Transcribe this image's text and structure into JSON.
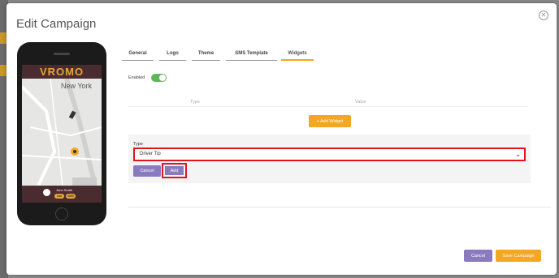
{
  "modal": {
    "title": "Edit Campaign",
    "close_icon": "close-icon"
  },
  "phone": {
    "brand": "VROMO",
    "city": "New York",
    "driver_name": "John Smith",
    "chip_call": "Call",
    "chip_sms": "SMS"
  },
  "tabs": [
    {
      "label": "General",
      "active": false
    },
    {
      "label": "Logo",
      "active": false
    },
    {
      "label": "Theme",
      "active": false
    },
    {
      "label": "SMS Template",
      "active": false
    },
    {
      "label": "Widgets",
      "active": true
    }
  ],
  "widgets": {
    "enabled_label": "Enabled",
    "enabled": true,
    "col_type": "Type",
    "col_value": "Value",
    "add_widget_label": "+ Add Widget",
    "form": {
      "type_label": "Type",
      "type_value": "Driver Tip",
      "cancel_label": "Cancel",
      "add_label": "Add"
    }
  },
  "footer": {
    "cancel_label": "Cancel",
    "save_label": "Save Campaign"
  },
  "colors": {
    "accent": "#f5a623",
    "secondary": "#8a7bbf",
    "highlight": "#e0151f",
    "toggle_on": "#5cb85c",
    "brand_bar": "#4a2b30"
  }
}
